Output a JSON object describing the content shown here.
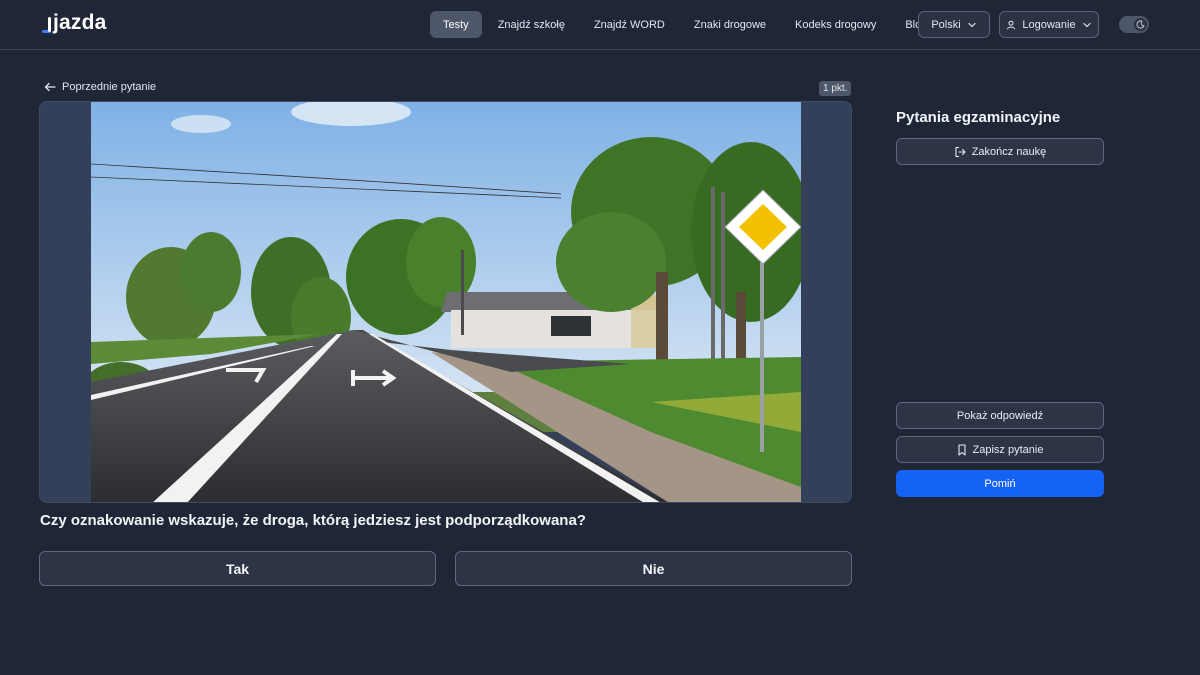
{
  "brand": {
    "name": "jazda",
    "accent": "#3d7bff"
  },
  "nav": {
    "items": [
      {
        "label": "Testy",
        "active": true
      },
      {
        "label": "Znajdź szkołę",
        "active": false
      },
      {
        "label": "Znajdź WORD",
        "active": false
      },
      {
        "label": "Znaki drogowe",
        "active": false
      },
      {
        "label": "Kodeks drogowy",
        "active": false
      },
      {
        "label": "Blog",
        "active": false
      }
    ],
    "language": "Polski",
    "login": "Logowanie"
  },
  "question_panel": {
    "prev_label": "Poprzednie pytanie",
    "points": "1 pkt.",
    "question": "Czy oznakowanie wskazuje, że droga, którą jedziesz jest podporządkowana?",
    "answers": [
      "Tak",
      "Nie"
    ]
  },
  "sidebar": {
    "title": "Pytania egzaminacyjne",
    "end_label": "Zakończ naukę",
    "show_answer_label": "Pokaż odpowiedź",
    "save_label": "Zapisz pytanie",
    "skip_label": "Pomiń"
  },
  "colors": {
    "background": "#1f2636",
    "primary_button": "#1463f3",
    "active_nav": "#4e5769"
  },
  "icons": {
    "prev": "arrow-left-icon",
    "end": "logout-icon",
    "save": "bookmark-icon",
    "login": "user-icon",
    "theme": "moon-icon",
    "dropdown": "chevron-down-icon"
  }
}
